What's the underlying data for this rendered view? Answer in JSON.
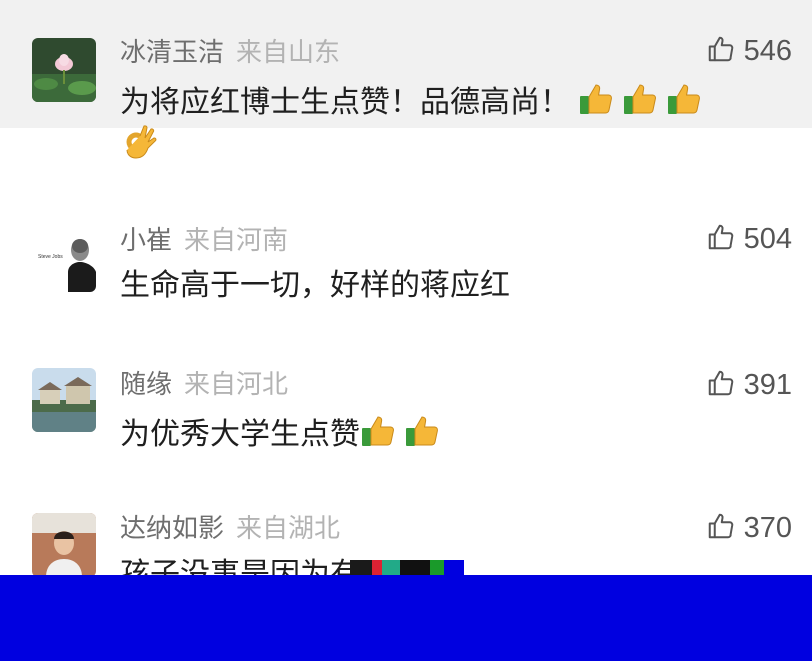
{
  "comments": [
    {
      "username": "冰清玉洁",
      "location": "来自山东",
      "likes": "546",
      "text": "为将应红博士生点赞！品德高尚！",
      "emojis": [
        "thumbs-up",
        "thumbs-up",
        "thumbs-up"
      ],
      "emojis_line2": [
        "ok-hand"
      ]
    },
    {
      "username": "小崔",
      "location": "来自河南",
      "likes": "504",
      "text": "生命高于一切，好样的蒋应红",
      "avatar_caption": "Steve Jobs"
    },
    {
      "username": "随缘",
      "location": "来自河北",
      "likes": "391",
      "text": "为优秀大学生点赞",
      "emojis": [
        "thumbs-up",
        "thumbs-up"
      ]
    },
    {
      "username": "达纳如影",
      "location": "来自湖北",
      "likes": "370",
      "text": "孩子没事是因为有"
    }
  ],
  "colors": {
    "highlight_bg": "#f1f1f1",
    "overlay": "#0000e0",
    "username": "#6e6e6e",
    "location": "#b3b3b3"
  },
  "icons": {
    "like": "thumbs-up-outline-icon"
  }
}
